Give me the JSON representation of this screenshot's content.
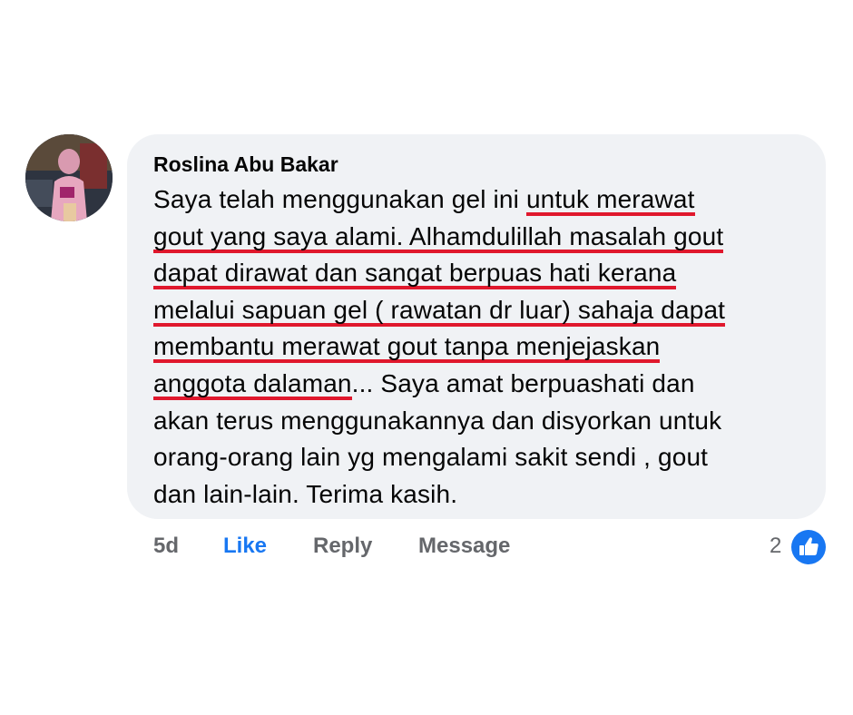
{
  "comment": {
    "author": "Roslina Abu Bakar",
    "lines": [
      [
        "Saya telah menggunakan gel ini ",
        "untuk merawat"
      ],
      [
        "gout yang saya alami. Alhamdulillah masalah gout",
        ""
      ],
      [
        "dapat dirawat dan sangat berpuas hati kerana",
        ""
      ],
      [
        "melalui sapuan gel ( rawatan dr luar) sahaja dapat",
        ""
      ],
      [
        "membantu merawat gout tanpa menjejaskan",
        ""
      ],
      [
        "anggota dalaman",
        "... Saya amat berpuashati dan"
      ],
      [
        "akan terus menggunakannya dan disyorkan untuk",
        ""
      ],
      [
        "orang-orang lain yg mengalami sakit sendi , gout",
        ""
      ],
      [
        "dan lain-lain. Terima kasih.",
        ""
      ]
    ]
  },
  "actions": {
    "time": "5d",
    "like": "Like",
    "reply": "Reply",
    "message": "Message"
  },
  "reactions": {
    "count": "2",
    "icon": "thumbs-up-icon",
    "color": "#1877f2"
  },
  "highlight_color": "#e0182d"
}
